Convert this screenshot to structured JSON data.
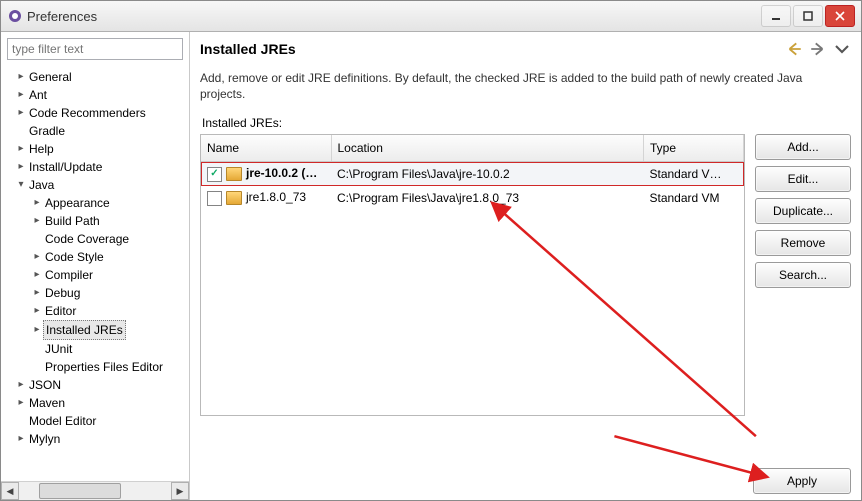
{
  "window": {
    "title": "Preferences"
  },
  "sidebar": {
    "filter_placeholder": "type filter text",
    "items": [
      {
        "label": "General",
        "expandable": true
      },
      {
        "label": "Ant",
        "expandable": true
      },
      {
        "label": "Code Recommenders",
        "expandable": true
      },
      {
        "label": "Gradle",
        "expandable": false
      },
      {
        "label": "Help",
        "expandable": true
      },
      {
        "label": "Install/Update",
        "expandable": true
      },
      {
        "label": "Java",
        "expandable": true,
        "expanded": true,
        "children": [
          {
            "label": "Appearance",
            "expandable": true
          },
          {
            "label": "Build Path",
            "expandable": true
          },
          {
            "label": "Code Coverage",
            "expandable": false
          },
          {
            "label": "Code Style",
            "expandable": true
          },
          {
            "label": "Compiler",
            "expandable": true
          },
          {
            "label": "Debug",
            "expandable": true
          },
          {
            "label": "Editor",
            "expandable": true
          },
          {
            "label": "Installed JREs",
            "expandable": true,
            "selected": true
          },
          {
            "label": "JUnit",
            "expandable": false
          },
          {
            "label": "Properties Files Editor",
            "expandable": false
          }
        ]
      },
      {
        "label": "JSON",
        "expandable": true
      },
      {
        "label": "Maven",
        "expandable": true
      },
      {
        "label": "Model Editor",
        "expandable": false
      },
      {
        "label": "Mylyn",
        "expandable": true
      }
    ]
  },
  "page": {
    "title": "Installed JREs",
    "description": "Add, remove or edit JRE definitions. By default, the checked JRE is added to the build path of newly created Java projects.",
    "list_label": "Installed JREs:",
    "columns": {
      "name": "Name",
      "location": "Location",
      "type": "Type"
    },
    "rows": [
      {
        "checked": true,
        "name": "jre-10.0.2 (…",
        "location": "C:\\Program Files\\Java\\jre-10.0.2",
        "type": "Standard V…",
        "selected": true
      },
      {
        "checked": false,
        "name": "jre1.8.0_73",
        "location": "C:\\Program Files\\Java\\jre1.8.0_73",
        "type": "Standard VM",
        "selected": false
      }
    ],
    "buttons": {
      "add": "Add...",
      "edit": "Edit...",
      "duplicate": "Duplicate...",
      "remove": "Remove",
      "search": "Search...",
      "apply": "Apply"
    }
  }
}
